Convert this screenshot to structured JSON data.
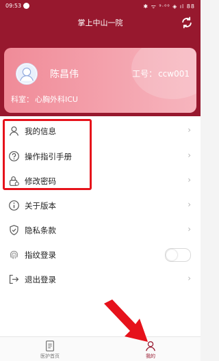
{
  "status": {
    "time": "09:53",
    "indicators": "✱ ᯤ ⁹·⁰⁰ ◈ ıl 88"
  },
  "header": {
    "title": "掌上中山一院",
    "refresh_icon": "refresh-icon"
  },
  "profile": {
    "name": "陈昌伟",
    "staff_label": "工号：",
    "staff_id": "ccw001",
    "dept_label": "科室：",
    "dept": "心胸外科ICU"
  },
  "menu": {
    "items": [
      {
        "label": "我的信息",
        "icon": "user-icon"
      },
      {
        "label": "操作指引手册",
        "icon": "help-icon"
      },
      {
        "label": "修改密码",
        "icon": "lock-icon"
      },
      {
        "label": "关于版本",
        "icon": "info-icon"
      },
      {
        "label": "隐私条款",
        "icon": "shield-icon"
      },
      {
        "label": "指纹登录",
        "icon": "fingerprint-icon",
        "toggle": false
      },
      {
        "label": "退出登录",
        "icon": "logout-icon"
      }
    ],
    "arrow": "›"
  },
  "tabs": [
    {
      "label": "医护首页",
      "icon": "document-icon"
    },
    {
      "label": "我的",
      "icon": "user-icon",
      "active": true
    }
  ],
  "colors": {
    "primary": "#97182e",
    "highlight": "#e6121b"
  }
}
